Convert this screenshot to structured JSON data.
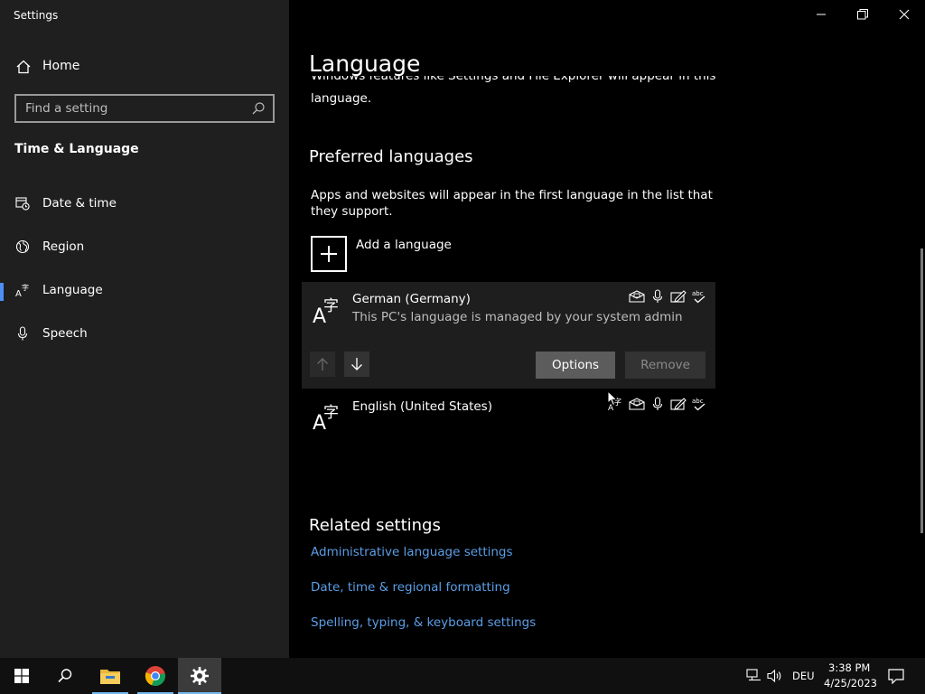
{
  "window": {
    "title": "Settings"
  },
  "nav": {
    "home_label": "Home",
    "search_placeholder": "Find a setting",
    "section_title": "Time & Language",
    "items": [
      {
        "label": "Date & time",
        "icon": "calendar-clock-icon",
        "selected": false
      },
      {
        "label": "Region",
        "icon": "globe-icon",
        "selected": false
      },
      {
        "label": "Language",
        "icon": "language-icon",
        "selected": true
      },
      {
        "label": "Speech",
        "icon": "microphone-icon",
        "selected": false
      }
    ]
  },
  "main": {
    "title": "Language",
    "intro_line1": "Windows features like Settings and File Explorer will appear in this",
    "intro_line2": "language.",
    "preferred_heading": "Preferred languages",
    "preferred_desc": "Apps and websites will appear in the first language in the list that they support.",
    "add_language_label": "Add a language",
    "languages": [
      {
        "name": "German (Germany)",
        "subtext": "This PC's language is managed by your system admin",
        "options_label": "Options",
        "remove_label": "Remove",
        "features": [
          "display-language-icon",
          "speech-icon",
          "handwriting-icon",
          "spellcheck-icon"
        ]
      },
      {
        "name": "English (United States)",
        "features": [
          "language-pack-icon",
          "display-language-icon",
          "speech-icon",
          "handwriting-icon",
          "spellcheck-icon"
        ]
      }
    ],
    "related_heading": "Related settings",
    "related_links": [
      "Administrative language settings",
      "Date, time & regional formatting",
      "Spelling, typing, & keyboard settings"
    ]
  },
  "taskbar": {
    "input_language": "DEU",
    "time": "3:38 PM",
    "date": "4/25/2023"
  },
  "colors": {
    "nav_bg": "#1f1f1f",
    "main_bg": "#000000",
    "accent": "#4c8ff7",
    "link": "#5b9ee6"
  }
}
